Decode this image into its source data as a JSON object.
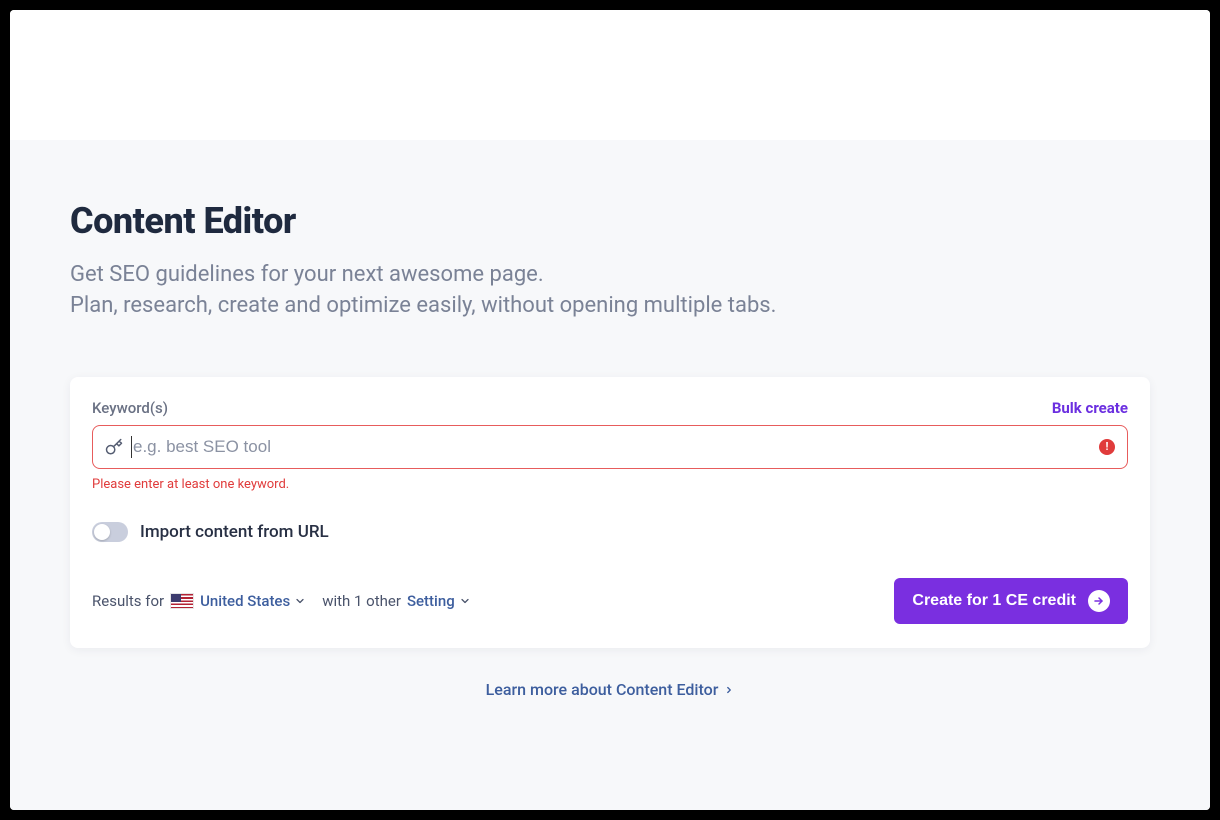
{
  "header": {
    "title": "Content Editor",
    "subtitle_line1": "Get SEO guidelines for your next awesome page.",
    "subtitle_line2": "Plan, research, create and optimize easily, without opening multiple tabs."
  },
  "form": {
    "keyword_label": "Keyword(s)",
    "bulk_create": "Bulk create",
    "input_placeholder": "e.g. best SEO tool",
    "input_value": "",
    "error_message": "Please enter at least one keyword.",
    "import_toggle_label": "Import content from URL",
    "results_prefix": "Results for",
    "country": "United States",
    "with_text": "with 1 other",
    "setting_text": "Setting",
    "create_button": "Create for 1 CE credit"
  },
  "footer": {
    "learn_more": "Learn more about Content Editor"
  },
  "icons": {
    "key": "key-icon",
    "error": "error-icon",
    "chevron_down": "chevron-down-icon",
    "arrow_right": "arrow-right-icon",
    "chevron_right": "chevron-right-icon",
    "us_flag": "us-flag-icon"
  },
  "colors": {
    "accent": "#7a2fe0",
    "error": "#e03b3b",
    "link_blue": "#3d5e9e"
  }
}
